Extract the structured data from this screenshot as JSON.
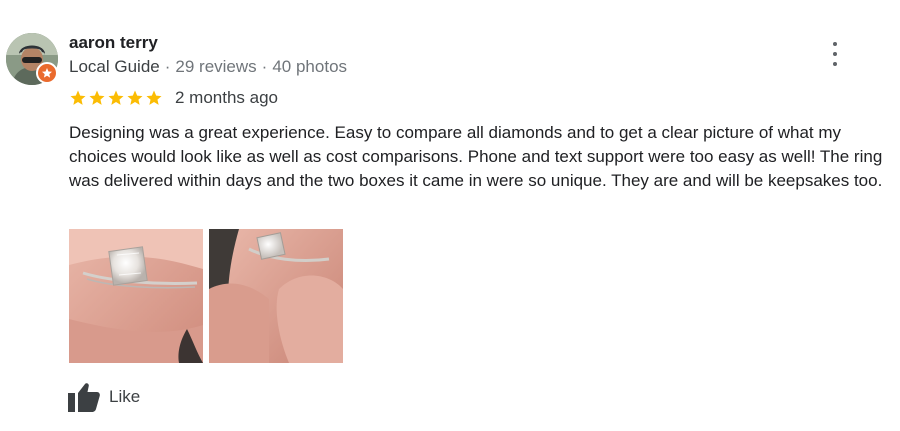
{
  "reviewer": {
    "name": "aaron terry",
    "badge": "Local Guide",
    "reviews": "29 reviews",
    "photos": "40 photos"
  },
  "rating": {
    "stars": 5,
    "max": 5,
    "date": "2 months ago"
  },
  "review_text": "Designing was a great experience. Easy to compare all diamonds and to get a clear picture of what my choices would look like as well as cost comparisons. Phone and text support were too easy as well! The ring was delivered within days and the two boxes it came in were so unique. They are and will be keepsakes too.",
  "actions": {
    "like_label": "Like"
  },
  "icons": {
    "star": "star-icon",
    "more": "more-vert-icon",
    "thumb": "thumb-up-icon",
    "guide": "local-guide-badge-icon"
  },
  "colors": {
    "star": "#fbbc04",
    "guide_badge": "#ea6a2d",
    "text_primary": "#202124",
    "text_secondary": "#3c4043"
  }
}
